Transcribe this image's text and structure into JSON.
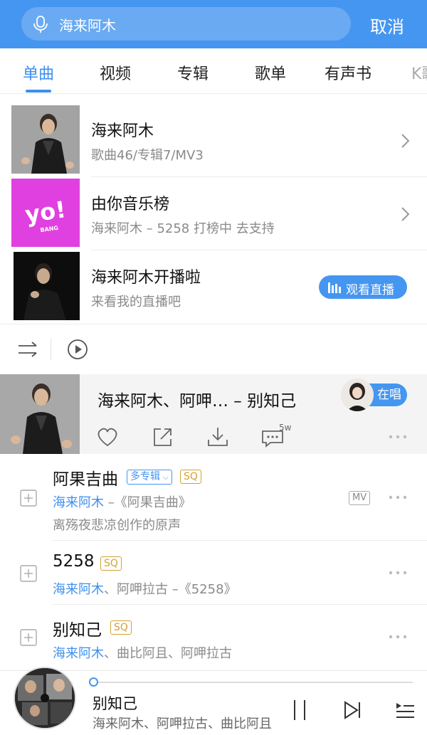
{
  "search": {
    "query": "海来阿木",
    "cancel_label": "取消"
  },
  "tabs": [
    {
      "label": "单曲",
      "active": true
    },
    {
      "label": "视频"
    },
    {
      "label": "专辑"
    },
    {
      "label": "歌单"
    },
    {
      "label": "有声书"
    },
    {
      "label": "K歌"
    }
  ],
  "results": [
    {
      "title": "海来阿木",
      "subtitle": "歌曲46/专辑7/MV3",
      "icon": "chevron-right-icon"
    },
    {
      "title": "由你音乐榜",
      "subtitle": "海来阿木 – 5258 打榜中 去支持",
      "logo_text": "yo!",
      "logo_sub": "BANG",
      "logo_color": "#e040e0",
      "icon": "chevron-right-icon"
    },
    {
      "title": "海来阿木开播啦",
      "subtitle": "来看我的直播吧",
      "button": "观看直播"
    }
  ],
  "featured": {
    "title": "海来阿木、阿呷… – 别知己",
    "badge": "在唱",
    "comment_count": "5w",
    "actions": [
      "heart-icon",
      "share-icon",
      "download-icon",
      "comment-icon",
      "more-icon"
    ]
  },
  "songs": [
    {
      "title": "阿果吉曲",
      "tags": [
        "多专辑",
        "SQ"
      ],
      "artist": "海来阿木",
      "rest": " –《阿果吉曲》",
      "mv": "MV",
      "desc": "离殇夜悲凉创作的原声"
    },
    {
      "title": "5258",
      "tags": [
        "SQ"
      ],
      "artist": "海来阿木",
      "rest": "、阿呷拉古 –《5258》"
    },
    {
      "title": "别知己",
      "tags": [
        "SQ"
      ],
      "artist": "海来阿木",
      "rest": "、曲比阿且、阿呷拉古"
    }
  ],
  "player": {
    "title": "别知己",
    "artists": "海来阿木、阿呷拉古、曲比阿且",
    "progress": 0.0
  },
  "colors": {
    "accent": "#4596f0",
    "gold_tag": "#d1a233"
  }
}
